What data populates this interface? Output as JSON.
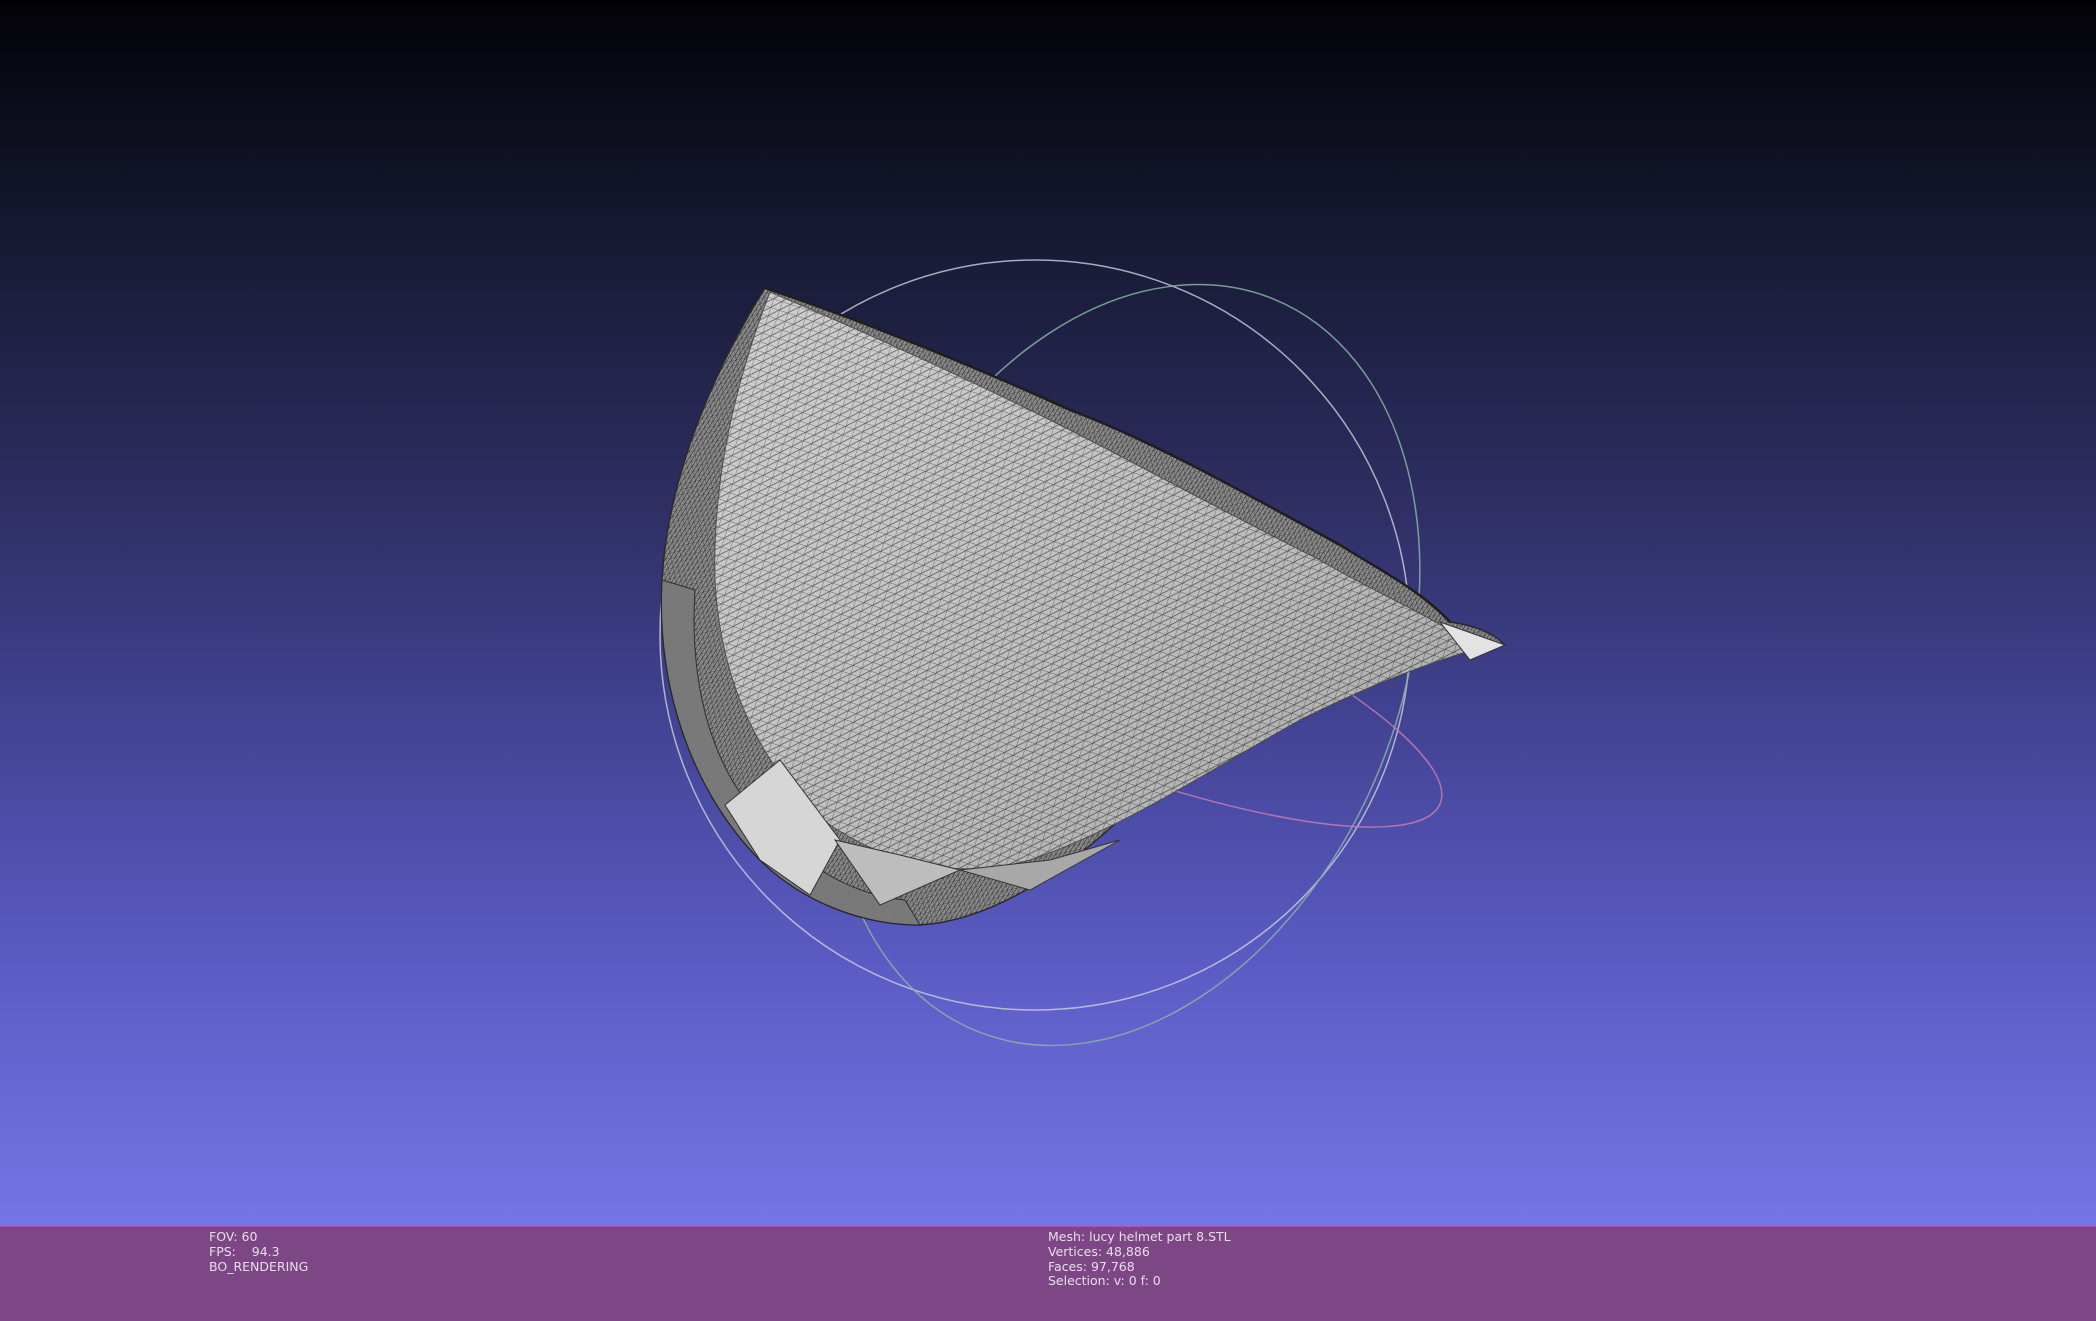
{
  "viewport": {
    "background_top": "#020206",
    "background_bottom": "#7575e6",
    "mesh_color": "#cdcdcd",
    "wire_color": "#3c3c3c",
    "trackball_colors": [
      "#cfd0df",
      "#89b3a7",
      "#c37db4"
    ]
  },
  "info_left": {
    "fov": "FOV: 60",
    "fps": "FPS:    94.3",
    "render_mode": "BO_RENDERING"
  },
  "info_right": {
    "mesh": "Mesh: lucy helmet part 8.STL",
    "vertices": "Vertices: 48,886",
    "faces": "Faces: 97,768",
    "selection": "Selection: v: 0 f: 0"
  },
  "info_bar_color": "#7d4685"
}
